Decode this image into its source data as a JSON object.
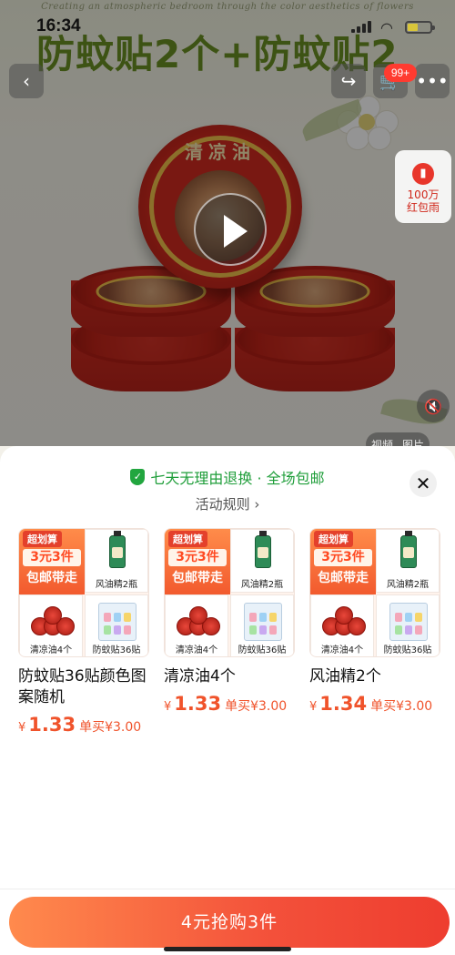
{
  "status_bar": {
    "time": "16:34"
  },
  "background": {
    "banner_text": "Creating an atmospheric bedroom through the color aesthetics of flowers",
    "title": "防蚊贴2个+防蚊贴2",
    "tin_label": "清凉油",
    "cart_badge": "99+",
    "red_packet": {
      "line1": "100万",
      "line2": "红包雨"
    },
    "media_tabs": [
      "视频",
      "图片"
    ]
  },
  "sheet": {
    "guarantee": "七天无理由退换 · 全场包邮",
    "rules": "活动规则 ›",
    "promo": {
      "tag": "超划算",
      "line1": "3元3件",
      "line2": "包邮带走",
      "cells": {
        "oil": "风油精2瓶",
        "balm": "清凉油4个",
        "patch": "防蚊贴36贴"
      }
    },
    "products": [
      {
        "name": "防蚊贴36贴颜色图案随机",
        "currency": "¥",
        "price": "1.33",
        "single_price": "单买¥3.00"
      },
      {
        "name": "清凉油4个",
        "currency": "¥",
        "price": "1.33",
        "single_price": "单买¥3.00"
      },
      {
        "name": "风油精2个",
        "currency": "¥",
        "price": "1.34",
        "single_price": "单买¥3.00"
      }
    ],
    "buy_button": "4元抢购3件"
  },
  "colors": {
    "accent": "#f0532b",
    "guarantee_green": "#1f9e3a",
    "buy_gradient_start": "#ff8a4d",
    "buy_gradient_end": "#ee3d2f"
  },
  "icons": [
    "back-icon",
    "share-icon",
    "cart-icon",
    "more-icon",
    "red-packet-icon",
    "play-icon",
    "mute-icon",
    "shield-check-icon",
    "close-icon"
  ]
}
